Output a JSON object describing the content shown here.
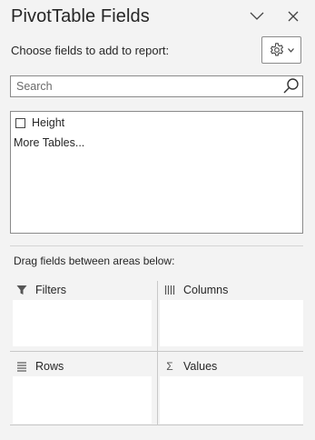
{
  "pane": {
    "title": "PivotTable Fields",
    "subtitle": "Choose fields to add to report:"
  },
  "search": {
    "placeholder": "Search",
    "value": ""
  },
  "fields": [
    {
      "label": "Height",
      "checked": false
    }
  ],
  "more_tables_label": "More Tables...",
  "drag_label": "Drag fields between areas below:",
  "areas": {
    "filters": "Filters",
    "columns": "Columns",
    "rows": "Rows",
    "values": "Values"
  }
}
